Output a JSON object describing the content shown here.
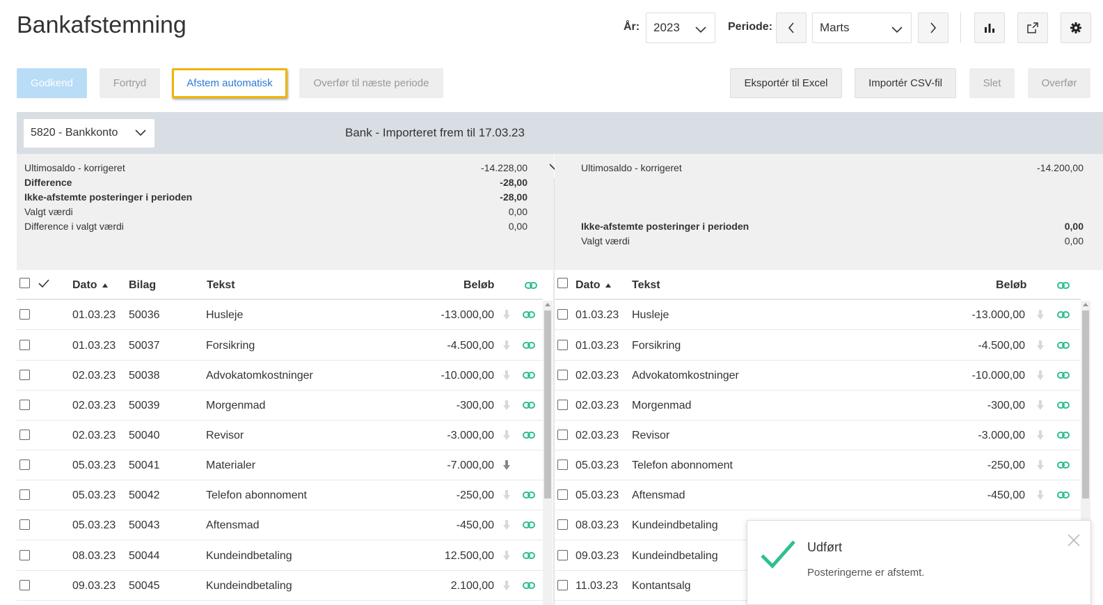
{
  "page": {
    "title": "Bankafstemning"
  },
  "controls": {
    "year_label": "År:",
    "year_value": "2023",
    "period_label": "Periode:",
    "period_value": "Marts"
  },
  "toolbar": {
    "approve": "Godkend",
    "undo": "Fortryd",
    "auto_reconcile": "Afstem automatisk",
    "transfer_next": "Overfør til næste periode",
    "export_excel": "Eksportér til Excel",
    "import_csv": "Importér CSV-fil",
    "delete": "Slet",
    "transfer": "Overfør"
  },
  "account": {
    "selected": "5820 - Bankkonto",
    "bank_title": "Bank - Importeret frem til 17.03.23"
  },
  "summary_left": [
    {
      "label": "Ultimosaldo - korrigeret",
      "value": "-14.228,00",
      "bold": false
    },
    {
      "label": "Difference",
      "value": "-28,00",
      "bold": true
    },
    {
      "label": "Ikke-afstemte posteringer i perioden",
      "value": "-28,00",
      "bold": true
    },
    {
      "label": "Valgt værdi",
      "value": "0,00",
      "bold": false
    },
    {
      "label": "Difference i valgt værdi",
      "value": "0,00",
      "bold": false
    }
  ],
  "summary_right": {
    "closing_label": "Ultimosaldo - korrigeret",
    "closing_value": "-14.200,00",
    "unreconciled_label": "Ikke-afstemte posteringer i perioden",
    "unreconciled_value": "0,00",
    "selected_label": "Valgt værdi",
    "selected_value": "0,00"
  },
  "ledger": {
    "headers": {
      "date": "Dato",
      "voucher": "Bilag",
      "text": "Tekst",
      "amount": "Beløb"
    },
    "rows": [
      {
        "date": "01.03.23",
        "voucher": "50036",
        "text": "Husleje",
        "amount": "-13.000,00",
        "linked": true
      },
      {
        "date": "01.03.23",
        "voucher": "50037",
        "text": "Forsikring",
        "amount": "-4.500,00",
        "linked": true
      },
      {
        "date": "02.03.23",
        "voucher": "50038",
        "text": "Advokatomkostninger",
        "amount": "-10.000,00",
        "linked": true
      },
      {
        "date": "02.03.23",
        "voucher": "50039",
        "text": "Morgenmad",
        "amount": "-300,00",
        "linked": true
      },
      {
        "date": "02.03.23",
        "voucher": "50040",
        "text": "Revisor",
        "amount": "-3.000,00",
        "linked": true
      },
      {
        "date": "05.03.23",
        "voucher": "50041",
        "text": "Materialer",
        "amount": "-7.000,00",
        "linked": false
      },
      {
        "date": "05.03.23",
        "voucher": "50042",
        "text": "Telefon abonnoment",
        "amount": "-250,00",
        "linked": true
      },
      {
        "date": "05.03.23",
        "voucher": "50043",
        "text": "Aftensmad",
        "amount": "-450,00",
        "linked": true
      },
      {
        "date": "08.03.23",
        "voucher": "50044",
        "text": "Kundeindbetaling",
        "amount": "12.500,00",
        "linked": true
      },
      {
        "date": "09.03.23",
        "voucher": "50045",
        "text": "Kundeindbetaling",
        "amount": "2.100,00",
        "linked": true
      }
    ]
  },
  "bank": {
    "headers": {
      "date": "Dato",
      "text": "Tekst",
      "amount": "Beløb"
    },
    "rows": [
      {
        "date": "01.03.23",
        "text": "Husleje",
        "amount": "-13.000,00",
        "linked": true
      },
      {
        "date": "01.03.23",
        "text": "Forsikring",
        "amount": "-4.500,00",
        "linked": true
      },
      {
        "date": "02.03.23",
        "text": "Advokatomkostninger",
        "amount": "-10.000,00",
        "linked": true
      },
      {
        "date": "02.03.23",
        "text": "Morgenmad",
        "amount": "-300,00",
        "linked": true
      },
      {
        "date": "02.03.23",
        "text": "Revisor",
        "amount": "-3.000,00",
        "linked": true
      },
      {
        "date": "05.03.23",
        "text": "Telefon abonnoment",
        "amount": "-250,00",
        "linked": true
      },
      {
        "date": "05.03.23",
        "text": "Aftensmad",
        "amount": "-450,00",
        "linked": true
      },
      {
        "date": "08.03.23",
        "text": "Kundeindbetaling",
        "amount": "",
        "linked": false
      },
      {
        "date": "09.03.23",
        "text": "Kundeindbetaling",
        "amount": "",
        "linked": false
      },
      {
        "date": "11.03.23",
        "text": "Kontantsalg",
        "amount": "",
        "linked": false
      }
    ]
  },
  "toast": {
    "title": "Udført",
    "message": "Posteringerne er afstemt."
  },
  "colors": {
    "link": "#2fbf8f",
    "accent": "#2b7bd6",
    "highlight": "#f0b400",
    "success": "#2fbf8f"
  }
}
